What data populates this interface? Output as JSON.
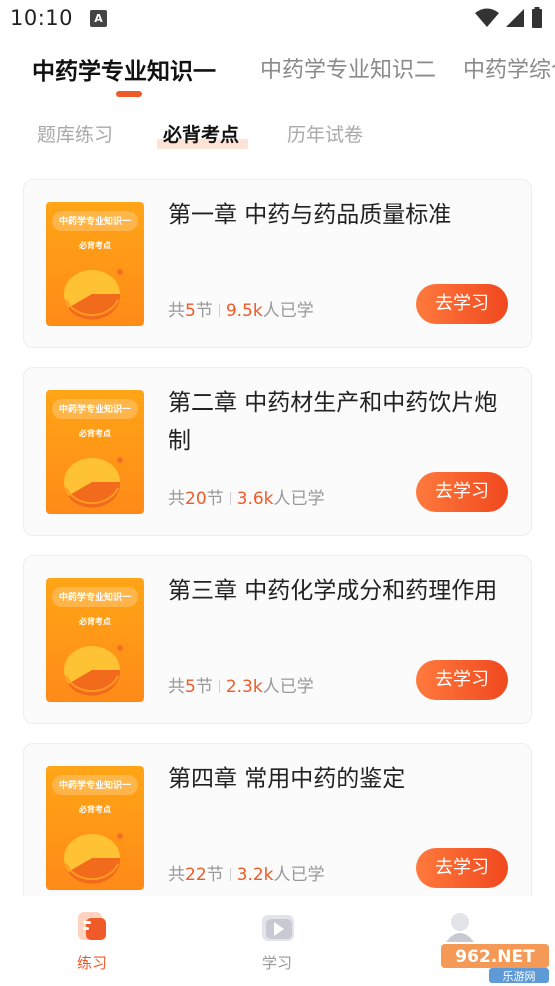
{
  "status_bar": {
    "time": "10:10",
    "notification_icon": "A"
  },
  "top_tabs": [
    {
      "label": "中药学专业知识一",
      "active": true
    },
    {
      "label": "中药学专业知识二",
      "active": false
    },
    {
      "label": "中药学综合",
      "active": false
    }
  ],
  "sub_tabs": [
    {
      "label": "题库练习",
      "active": false
    },
    {
      "label": "必背考点",
      "active": true
    },
    {
      "label": "历年试卷",
      "active": false
    }
  ],
  "cover": {
    "title": "中药学专业知识一",
    "subtitle": "必背考点"
  },
  "meta_labels": {
    "prefix": "共",
    "section_unit": "节",
    "learners_suffix": "人已学"
  },
  "chapters": [
    {
      "title": "第一章  中药与药品质量标准",
      "sections": "5",
      "learners": "9.5k",
      "button": "去学习"
    },
    {
      "title": "第二章  中药材生产和中药饮片炮制",
      "sections": "20",
      "learners": "3.6k",
      "button": "去学习"
    },
    {
      "title": "第三章  中药化学成分和药理作用",
      "sections": "5",
      "learners": "2.3k",
      "button": "去学习"
    },
    {
      "title": "第四章  常用中药的鉴定",
      "sections": "22",
      "learners": "3.2k",
      "button": "去学习"
    }
  ],
  "bottom_nav": [
    {
      "label": "练习",
      "icon": "practice-icon",
      "active": true
    },
    {
      "label": "学习",
      "icon": "video-icon",
      "active": false
    },
    {
      "label": "",
      "icon": "profile-icon",
      "active": false
    }
  ],
  "watermark": {
    "text": "962.NET",
    "subtext": "乐游网"
  },
  "colors": {
    "accent": "#f05a28",
    "cover_orange": "#ff9a17",
    "muted_text": "#999999"
  }
}
